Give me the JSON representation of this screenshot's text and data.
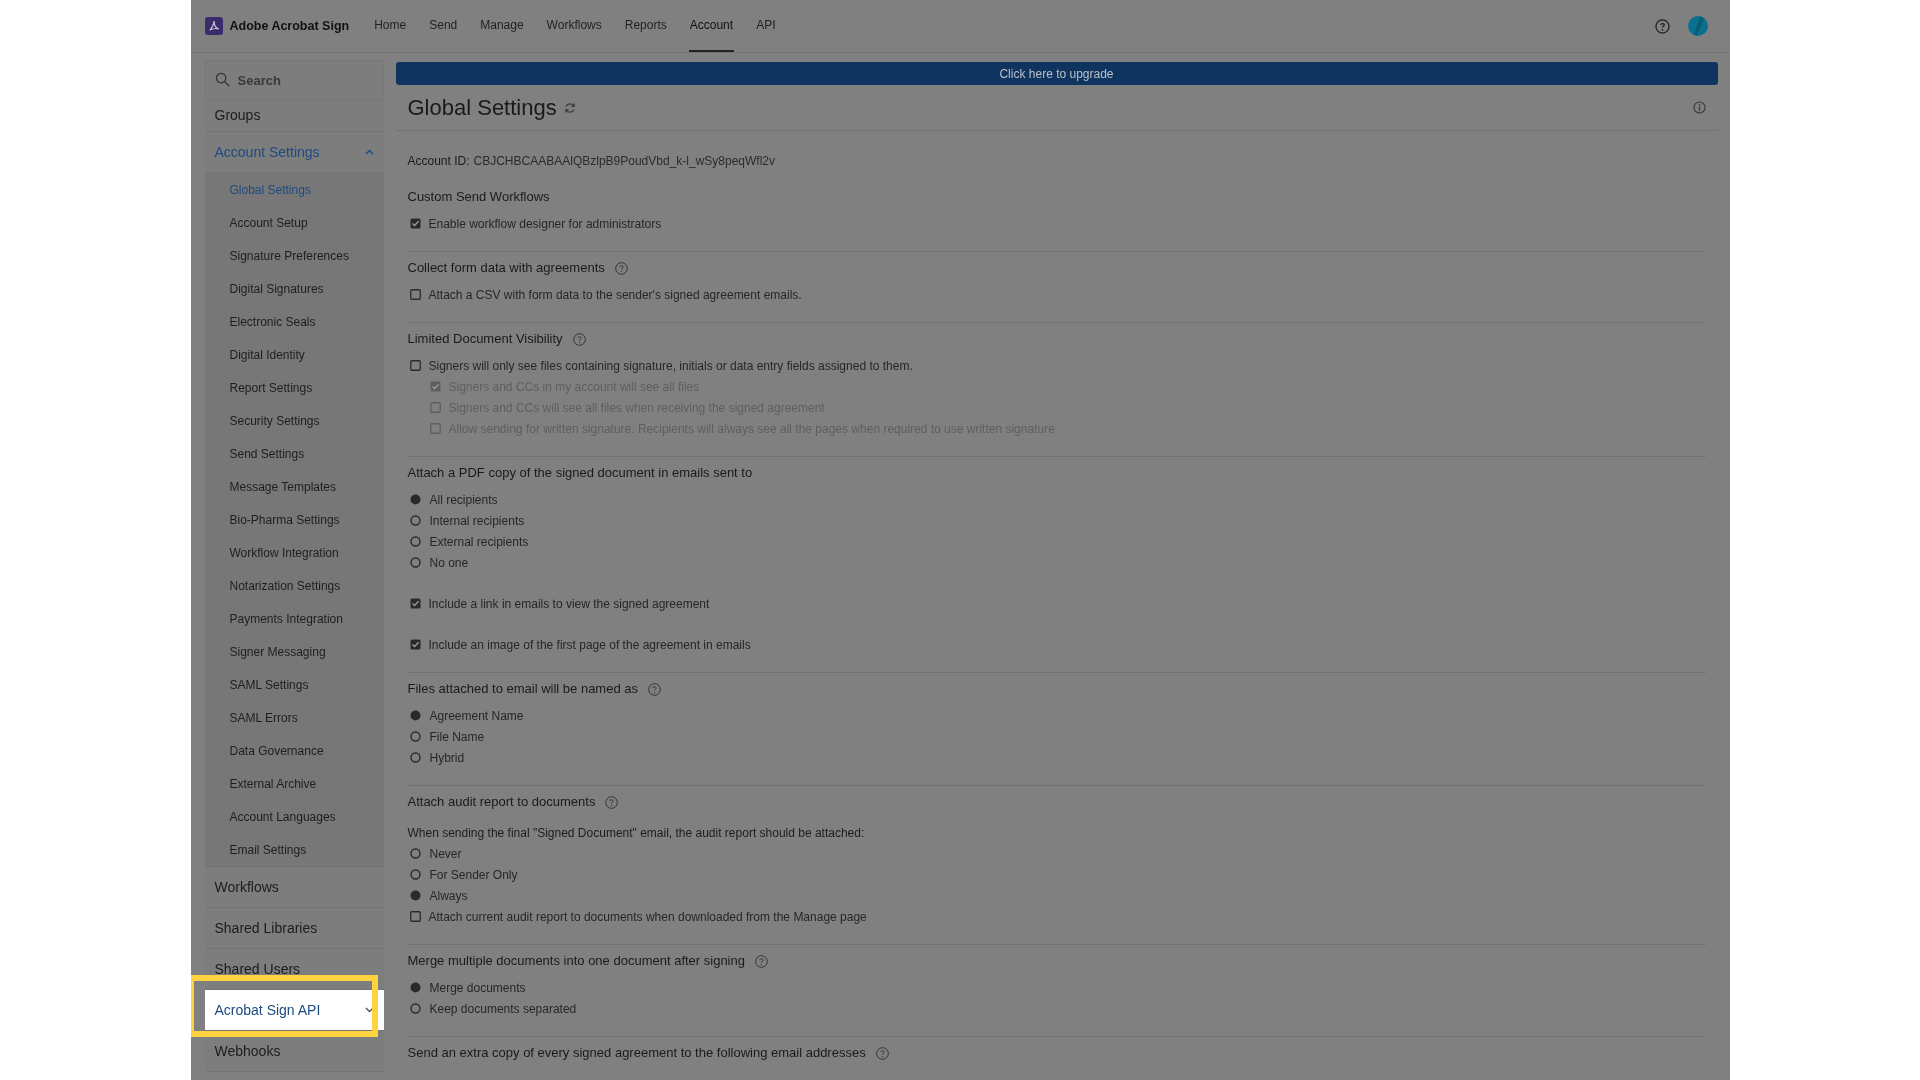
{
  "header": {
    "product": "Adobe Acrobat Sign",
    "nav": [
      {
        "label": "Home",
        "selected": false
      },
      {
        "label": "Send",
        "selected": false
      },
      {
        "label": "Manage",
        "selected": false
      },
      {
        "label": "Workflows",
        "selected": false
      },
      {
        "label": "Reports",
        "selected": false
      },
      {
        "label": "Account",
        "selected": true
      },
      {
        "label": "API",
        "selected": false
      }
    ]
  },
  "sidebar": {
    "search": {
      "placeholder": "Search"
    },
    "items": [
      {
        "label": "Groups",
        "selected": false
      },
      {
        "label": "Account Settings",
        "selected": true,
        "expanded": true,
        "children": [
          {
            "label": "Global Settings",
            "selected": true
          },
          {
            "label": "Account Setup",
            "selected": false
          },
          {
            "label": "Signature Preferences",
            "selected": false
          },
          {
            "label": "Digital Signatures",
            "selected": false
          },
          {
            "label": "Electronic Seals",
            "selected": false
          },
          {
            "label": "Digital Identity",
            "selected": false
          },
          {
            "label": "Report Settings",
            "selected": false
          },
          {
            "label": "Security Settings",
            "selected": false
          },
          {
            "label": "Send Settings",
            "selected": false
          },
          {
            "label": "Message Templates",
            "selected": false
          },
          {
            "label": "Bio-Pharma Settings",
            "selected": false
          },
          {
            "label": "Workflow Integration",
            "selected": false
          },
          {
            "label": "Notarization Settings",
            "selected": false
          },
          {
            "label": "Payments Integration",
            "selected": false
          },
          {
            "label": "Signer Messaging",
            "selected": false
          },
          {
            "label": "SAML Settings",
            "selected": false
          },
          {
            "label": "SAML Errors",
            "selected": false
          },
          {
            "label": "Data Governance",
            "selected": false
          },
          {
            "label": "External Archive",
            "selected": false
          },
          {
            "label": "Account Languages",
            "selected": false
          },
          {
            "label": "Email Settings",
            "selected": false
          }
        ]
      },
      {
        "label": "Workflows",
        "selected": false
      },
      {
        "label": "Shared Libraries",
        "selected": false
      },
      {
        "label": "Shared Users",
        "selected": false
      },
      {
        "label": "Acrobat Sign API",
        "selected": true,
        "expanded": false,
        "highlighted": true
      },
      {
        "label": "Webhooks",
        "selected": false
      }
    ]
  },
  "banner": "Click here to upgrade",
  "page": {
    "title": "Global Settings",
    "account_id_label": "Account ID:",
    "account_id": "CBJCHBCAABAAlQBzlpB9PoudVbd_k-l_wSy8peqWfl2v",
    "sections": [
      {
        "title": "Custom Send Workflows",
        "help": false,
        "groups": [
          [
            {
              "kind": "checkbox",
              "label": "Enable workflow designer for administrators",
              "checked": true,
              "disabled": false
            }
          ]
        ]
      },
      {
        "title": "Collect form data with agreements",
        "help": true,
        "groups": [
          [
            {
              "kind": "checkbox",
              "label": "Attach a CSV with form data to the sender's signed agreement emails.",
              "checked": false,
              "disabled": false
            }
          ]
        ]
      },
      {
        "title": "Limited Document Visibility",
        "help": true,
        "groups": [
          [
            {
              "kind": "checkbox",
              "label": "Signers will only see files containing signature, initials or data entry fields assigned to them.",
              "checked": false,
              "disabled": false,
              "children": [
                {
                  "kind": "checkbox",
                  "label": "Signers and CCs in my account will see all files",
                  "checked": true,
                  "disabled": true
                },
                {
                  "kind": "checkbox",
                  "label": "Signers and CCs will see all files when receiving the signed agreement",
                  "checked": false,
                  "disabled": true
                },
                {
                  "kind": "checkbox",
                  "label": "Allow sending for written signature. Recipients will always see all the pages when required to use written signature",
                  "checked": false,
                  "disabled": true
                }
              ]
            }
          ]
        ]
      },
      {
        "title": "Attach a PDF copy of the signed document in emails sent to",
        "help": false,
        "groups": [
          [
            {
              "kind": "radio",
              "label": "All recipients",
              "selected": true
            },
            {
              "kind": "radio",
              "label": "Internal recipients",
              "selected": false
            },
            {
              "kind": "radio",
              "label": "External recipients",
              "selected": false
            },
            {
              "kind": "radio",
              "label": "No one",
              "selected": false
            }
          ],
          [
            {
              "kind": "checkbox",
              "label": "Include a link in emails to view the signed agreement",
              "checked": true,
              "disabled": false
            }
          ],
          [
            {
              "kind": "checkbox",
              "label": "Include an image of the first page of the agreement in emails",
              "checked": true,
              "disabled": false
            }
          ]
        ]
      },
      {
        "title": "Files attached to email will be named as",
        "help": true,
        "groups": [
          [
            {
              "kind": "radio",
              "label": "Agreement Name",
              "selected": true
            },
            {
              "kind": "radio",
              "label": "File Name",
              "selected": false
            },
            {
              "kind": "radio",
              "label": "Hybrid",
              "selected": false
            }
          ]
        ]
      },
      {
        "title": "Attach audit report to documents",
        "help": true,
        "groups": [
          [
            {
              "kind": "text",
              "label": "When sending the final \"Signed Document\" email, the audit report should be attached:"
            },
            {
              "kind": "radio",
              "label": "Never",
              "selected": false
            },
            {
              "kind": "radio",
              "label": "For Sender Only",
              "selected": false
            },
            {
              "kind": "radio",
              "label": "Always",
              "selected": true
            },
            {
              "kind": "checkbox",
              "label": "Attach current audit report to documents when downloaded from the Manage page",
              "checked": false,
              "disabled": false
            }
          ]
        ]
      },
      {
        "title": "Merge multiple documents into one document after signing",
        "help": true,
        "groups": [
          [
            {
              "kind": "radio",
              "label": "Merge documents",
              "selected": true
            },
            {
              "kind": "radio",
              "label": "Keep documents separated",
              "selected": false
            }
          ]
        ]
      },
      {
        "title": "Send an extra copy of every signed agreement to the following email addresses",
        "help": true
      }
    ]
  }
}
